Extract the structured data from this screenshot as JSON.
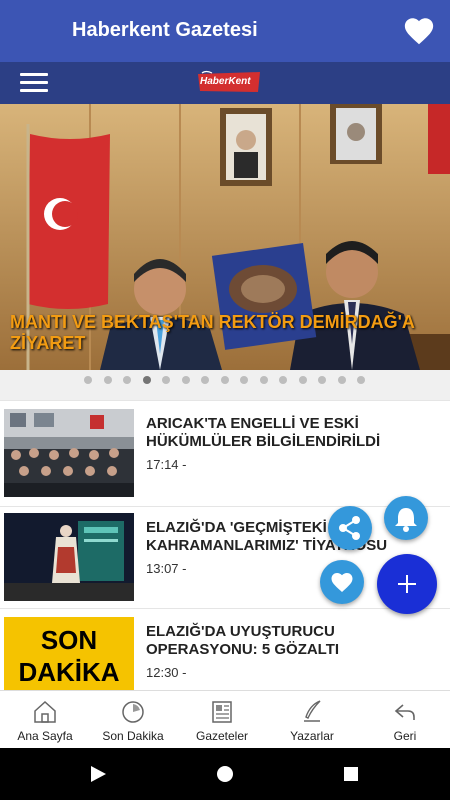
{
  "app": {
    "title": "Haberkent Gazetesi",
    "logo_text": "HaberKent"
  },
  "hero": {
    "title": "MANTI VE BEKTAŞ'TAN REKTÖR DEMİRDAĞ'A ZİYARET",
    "slide_count": 15,
    "active_slide": 4
  },
  "news": [
    {
      "title": "ARICAK'TA ENGELLİ VE ESKİ HÜKÜMLÜLER BİLGİLENDİRİLDİ",
      "time": "17:14 -"
    },
    {
      "title": "ELAZIĞ'DA 'GEÇMİŞTEKİ GİZLİ KAHRAMANLARIMIZ' TİYATROSU",
      "time": "13:07 -"
    },
    {
      "title": "ELAZIĞ'DA UYUŞTURUCU OPERASYONU: 5 GÖZALTI",
      "time": "12:30 -",
      "thumb_text_1": "SON",
      "thumb_text_2": "DAKİKA"
    }
  ],
  "bottom_nav": [
    {
      "label": "Ana Sayfa",
      "icon": "home-icon"
    },
    {
      "label": "Son Dakika",
      "icon": "clock-icon"
    },
    {
      "label": "Gazeteler",
      "icon": "newspaper-icon"
    },
    {
      "label": "Yazarlar",
      "icon": "quill-icon"
    },
    {
      "label": "Geri",
      "icon": "back-arrow-icon"
    }
  ],
  "colors": {
    "appbar": "#3c55b4",
    "navbar": "#2c3f85",
    "accent": "#3498db",
    "fab": "#1a2fd6",
    "hero_title": "#f39c12"
  }
}
